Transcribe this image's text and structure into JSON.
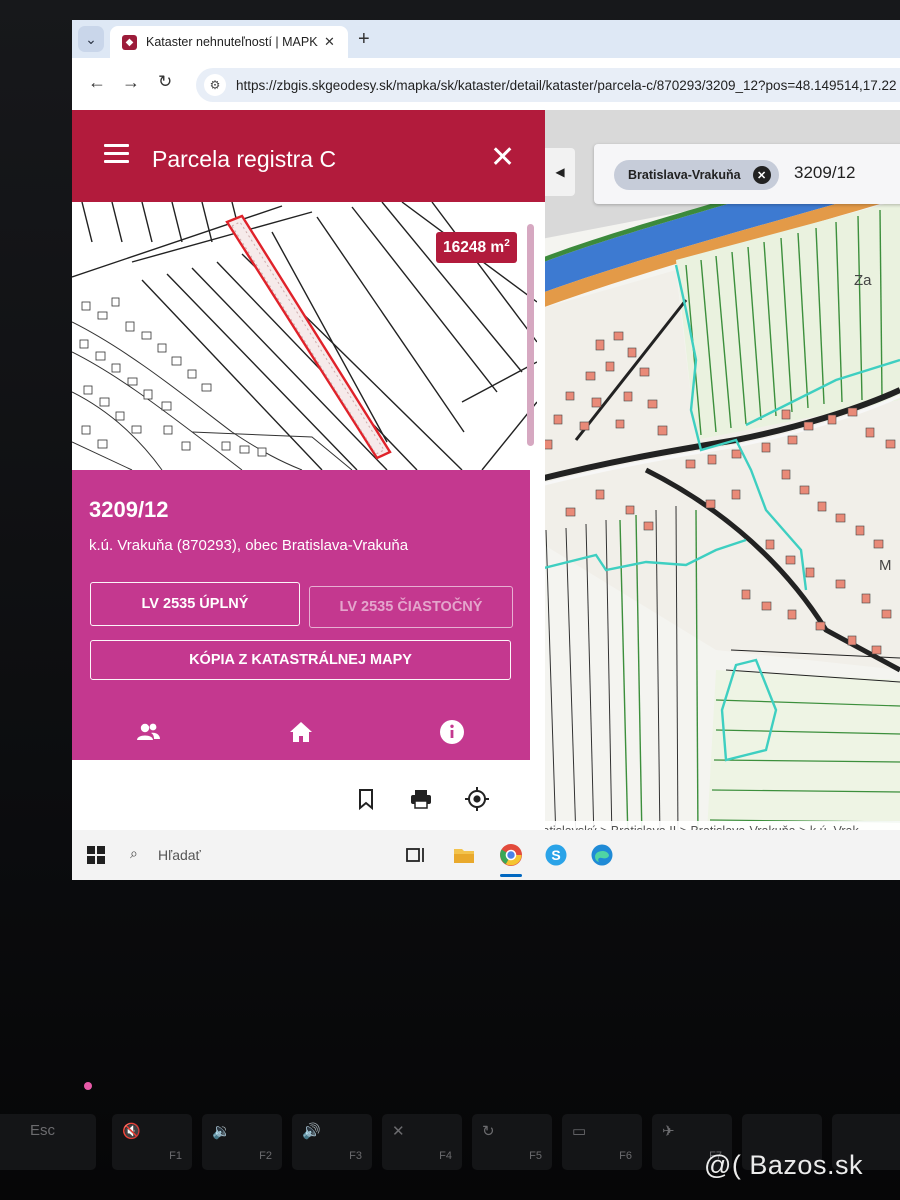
{
  "browser": {
    "tab_title": "Kataster nehnuteľností | MAPKA",
    "tab_close": "✕",
    "new_tab": "+",
    "url": "https://zbgis.skgeodesy.sk/mapka/sk/kataster/detail/kataster/parcela-c/870293/3209_12?pos=48.149514,17.22"
  },
  "panel": {
    "title": "Parcela registra C",
    "area_value": "16248 m",
    "area_unit_sup": "2",
    "parcel_number": "3209/12",
    "location": "k.ú. Vrakuňa (870293), obec Bratislava-Vrakuňa",
    "buttons": {
      "lv_full": "LV 2535 ÚPLNÝ",
      "lv_partial": "LV 2535 ČIASTOČNÝ",
      "map_copy": "KÓPIA Z KATASTRÁLNEJ MAPY"
    },
    "bottom_icons": [
      "owners-icon",
      "home-icon",
      "info-icon"
    ],
    "tools": [
      "bookmark-icon",
      "print-icon",
      "locate-icon"
    ]
  },
  "map": {
    "search_chip": "Bratislava-Vrakuňa",
    "search_value": "3209/12",
    "label_zah": "Za",
    "label_m": "M",
    "breadcrumb": "Bratislavský > Bratislava II > Bratislava-Vrakuňa > k.ú. Vrak"
  },
  "taskbar": {
    "search_placeholder": "Hľadať"
  },
  "keyboard": {
    "keys": [
      {
        "main": "Esc",
        "fn": ""
      },
      {
        "main": "🔇",
        "fn": "F1"
      },
      {
        "main": "🔉",
        "fn": "F2"
      },
      {
        "main": "🔊",
        "fn": "F3"
      },
      {
        "main": "✕",
        "fn": "F4"
      },
      {
        "main": "↻",
        "fn": "F5"
      },
      {
        "main": "▭",
        "fn": "F6"
      },
      {
        "main": "✈",
        "fn": "F7"
      }
    ]
  },
  "watermark": "@( Bazos.sk",
  "colors": {
    "header": "#b21b3c",
    "info_panel": "#c4388f",
    "area_badge": "#b21b3c",
    "parcel_highlight": "#e0222a",
    "cadastre_boundary": "#3ecfc1"
  }
}
